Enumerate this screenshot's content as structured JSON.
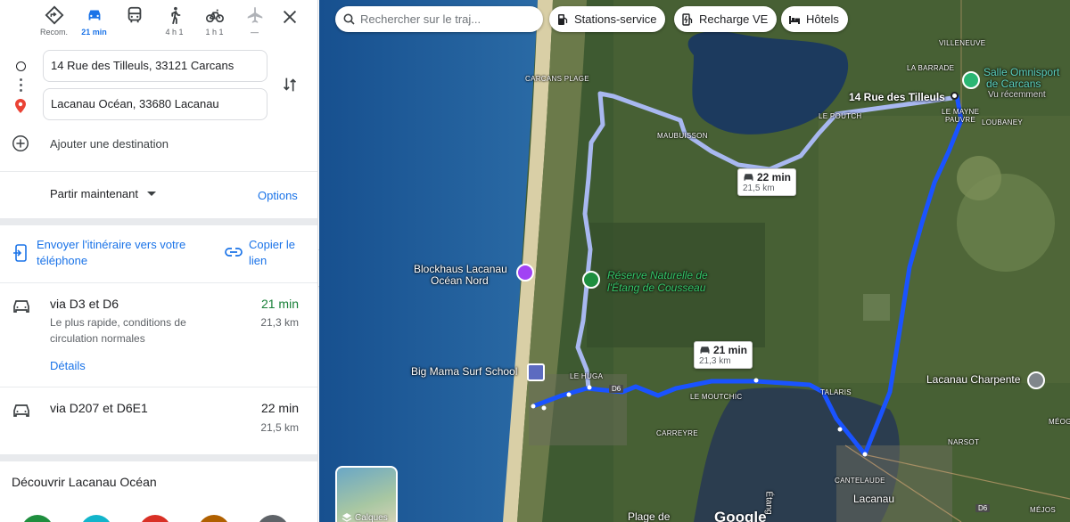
{
  "modes": [
    {
      "name": "recommended-mode",
      "label": "Recom.",
      "active": false
    },
    {
      "name": "car-mode",
      "label": "21 min",
      "active": true
    },
    {
      "name": "transit-mode",
      "label": "",
      "active": false
    },
    {
      "name": "walk-mode",
      "label": "4 h 1",
      "active": false
    },
    {
      "name": "bike-mode",
      "label": "1 h 1",
      "active": false
    },
    {
      "name": "flight-mode",
      "label": "—",
      "active": false
    }
  ],
  "waypoints": {
    "origin": "14 Rue des Tilleuls, 33121 Carcans",
    "destination": "Lacanau Océan, 33680 Lacanau",
    "add_label": "Ajouter une destination"
  },
  "depart": {
    "label": "Partir maintenant",
    "options": "Options"
  },
  "share": {
    "send": "Envoyer l'itinéraire vers votre téléphone",
    "copy": "Copier le lien"
  },
  "routes": [
    {
      "via": "via D3 et D6",
      "desc": "Le plus rapide, conditions de circulation normales",
      "duration": "21 min",
      "distance": "21,3 km",
      "details": "Détails"
    },
    {
      "via": "via D207 et D6E1",
      "duration": "22 min",
      "distance": "21,5 km"
    }
  ],
  "discover": "Découvrir Lacanau Océan",
  "map": {
    "search_placeholder": "Rechercher sur le traj...",
    "chips": [
      "Stations-service",
      "Recharge VE",
      "Hôtels"
    ],
    "route_bubbles": [
      {
        "time": "22 min",
        "distance": "21,5 km"
      },
      {
        "time": "21 min",
        "distance": "21,3 km"
      }
    ],
    "places": {
      "villeneuve": "VILLENEUVE",
      "la_barrade": "LA BARRADE",
      "carcans_plage": "CARCANS PLAGE",
      "le_poutch": "LE POUTCH",
      "le_mayne": "LE MAYNE",
      "pauvre": "PAUVRE",
      "loubaney": "LOUBANEY",
      "maubuisson": "MAUBUISSON",
      "le_huga": "LE HUGA",
      "le_moutchic": "LE MOUTCHIC",
      "talaris": "TALARIS",
      "carreyre": "CARREYRE",
      "narsot": "NARSOT",
      "cantelaude": "CANTELAUDE",
      "lacanau": "Lacanau",
      "mejos": "MÉJOS",
      "meog": "MÉOG",
      "plage_de": "Plage de",
      "etang": "Étang"
    },
    "pois": {
      "salle_line1": "Salle Omnisport",
      "salle_line2": "de Carcans",
      "salle_sub": "Vu récemment",
      "origin_pin": "14 Rue des Tilleuls",
      "blockhaus_line1": "Blockhaus Lacanau",
      "blockhaus_line2": "Océan Nord",
      "reserve_line1": "Réserve Naturelle de",
      "reserve_line2": "l'Étang de Cousseau",
      "big_mama": "Big Mama Surf School",
      "charpente": "Lacanau Charpente"
    },
    "road_tags": [
      "D6",
      "D6"
    ],
    "layers_label": "Calques",
    "google": "Google"
  },
  "colors": {
    "route_primary": "#1a53ff",
    "route_alt": "#a8b8f0",
    "accent": "#1a73e8",
    "fastest": "#188038"
  }
}
